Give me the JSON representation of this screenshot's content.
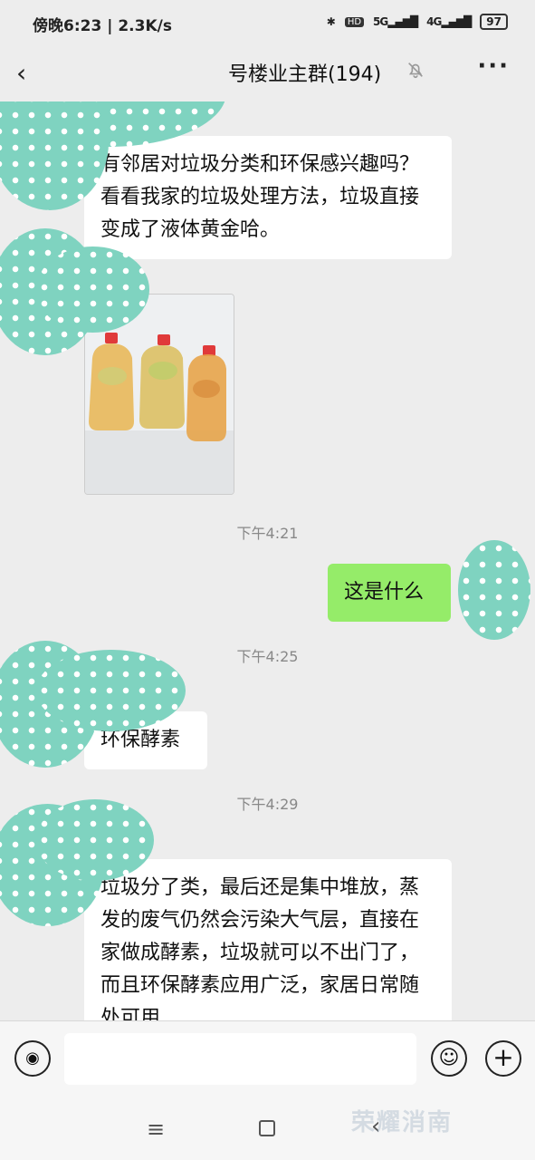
{
  "status_bar": {
    "time_speed": "傍晚6:23 | 2.3K/s",
    "signal_5g": "5G",
    "signal_4g": "4G",
    "hd": "HD",
    "battery": "97"
  },
  "header": {
    "title": "号楼业主群(194)",
    "more_label": "···"
  },
  "messages": [
    {
      "from": "other",
      "text": "有邻居对垃圾分类和环保感兴趣吗？看看我家的垃圾处理方法，垃圾直接变成了液体黄金哈。"
    },
    {
      "from": "other",
      "type": "image"
    },
    {
      "type": "time",
      "text": "下午4:21"
    },
    {
      "from": "me",
      "text": "这是什么"
    },
    {
      "type": "time",
      "text": "下午4:25"
    },
    {
      "from": "other",
      "text": "环保酵素"
    },
    {
      "type": "time",
      "text": "下午4:29"
    },
    {
      "from": "other",
      "text": "垃圾分了类，最后还是集中堆放，蒸发的废气仍然会污染大气层，直接在家做成酵素，垃圾就可以不出门了，而且环保酵素应用广泛，家居日常随处可用"
    }
  ],
  "watermark": "荣耀消南"
}
